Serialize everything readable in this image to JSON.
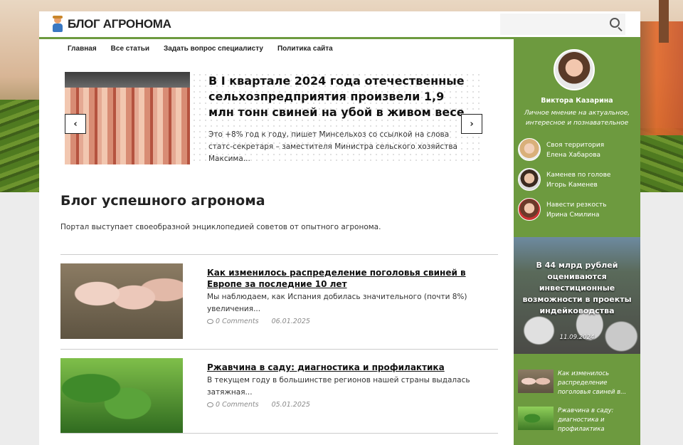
{
  "header": {
    "logo_text": "БЛОГ АГРОНОМА",
    "search_placeholder": ""
  },
  "nav": {
    "items": [
      {
        "label": "Главная"
      },
      {
        "label": "Все статьи"
      },
      {
        "label": "Задать вопрос специалисту"
      },
      {
        "label": "Политика сайта"
      }
    ]
  },
  "slider": {
    "title": "В I квартале 2024 года отечественные сельхозпредприятия произвели 1,9 млн тонн свиней на убой в живом весе",
    "text": "Это +8% год к году, пишет Минсельхоз со ссылкой на слова статс-секретаря – заместителя Министра сельского хозяйства Максима...",
    "prev_label": "‹",
    "next_label": "›"
  },
  "section": {
    "title": "Блог успешного агронома",
    "description": "Портал выступает своеобразной энциклопедией советов от опытного агронома."
  },
  "posts": [
    {
      "title": "Как изменилось распределение поголовья свиней в Европе за последние 10 лет",
      "excerpt": "Мы наблюдаем, как Испания добилась значительного (почти 8%) увеличения...",
      "comments": "0 Comments",
      "date": "06.01.2025"
    },
    {
      "title": "Ржавчина в саду: диагностика и профилактика",
      "excerpt": "В текущем году в большинстве регионов нашей страны выдалась затяжная...",
      "comments": "0 Comments",
      "date": "05.01.2025"
    }
  ],
  "sidebar": {
    "author_name": "Виктора Казарина",
    "author_desc": "Личное мнение на актуальное, интересное и познавательное",
    "blogs": [
      {
        "title": "Своя территория",
        "author": "Елена Хабарова"
      },
      {
        "title": "Каменев по голове",
        "author": "Игорь Каменев"
      },
      {
        "title": "Навести резкость",
        "author": "Ирина Смилина"
      }
    ],
    "featured": {
      "title": "В 44 млрд рублей оцениваются инвестиционные возможности в проекты индейководства",
      "date": "11.09.2024"
    },
    "recent": [
      {
        "title": "Как изменилось распределение поголовья свиней в..."
      },
      {
        "title": "Ржавчина в саду: диагностика и профилактика"
      }
    ]
  },
  "colors": {
    "accent_green": "#6d9a3f"
  }
}
